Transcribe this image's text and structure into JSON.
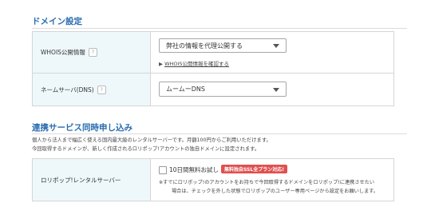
{
  "domain_settings": {
    "title": "ドメイン設定",
    "whois": {
      "label": "WHOIS公開情報",
      "help_icon": "?",
      "select_value": "弊社の情報を代理公開する",
      "link_prefix": "▶",
      "link_text": "WHOIS公開情報を確認する"
    },
    "nameserver": {
      "label": "ネームサーバ(DNS)",
      "help_icon": "?",
      "select_value": "ムームーDNS"
    }
  },
  "rental_server": {
    "title": "連携サービス同時申し込み",
    "description_line1": "個人から法人まで幅広く使える国内最大級のレンタルサーバーです。月額100円からご利用いただけます。",
    "description_line2": "今回取得するドメインが、新しく作成されるロリポップ!アカウントの独自ドメインに設定されます。",
    "row": {
      "label": "ロリポップ!レンタルサーバー",
      "checkbox_label": "10日間無料お試し",
      "checkbox_checked": false,
      "badge": "無料独自SSL全プラン対応!",
      "note_line1": "※すでにロリポップ!のアカウントをお持ちで今回取得するドメインをロリポップ!に連携させたい",
      "note_line2": "場合は、チェックを外した状態でロリポップのユーザー専用ページから設定をお願いします。"
    }
  },
  "colors": {
    "accent": "#2a6db0",
    "label_bg": "#eef8fb",
    "badge_bg": "#e05050"
  }
}
